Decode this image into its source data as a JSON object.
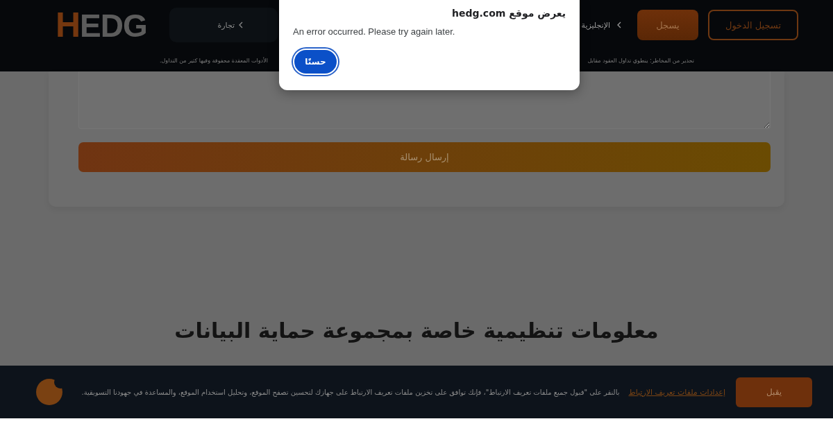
{
  "header": {
    "logo": {
      "accent": "H",
      "rest": "EDG"
    },
    "login_button": "تسجيل الدخول",
    "register_button": "يسجل",
    "language_menu": {
      "label": "الإنجليزية"
    },
    "trade_menu": {
      "label": "تجارة"
    },
    "risk_warning": [
      "تحذير من المخاطر: ينطوي تداول العقود مقابل",
      "الأدوات المعقدة محفوفة وفيها كثير من التداول."
    ]
  },
  "contact_form": {
    "send_button": "إرسال رسالة"
  },
  "section_heading": "معلومات تنظيمية خاصة بمجموعة حماية البيانات",
  "cookie_banner": {
    "accept_button": "يقبل",
    "settings_link": "إعدادات ملفات تعريف الارتباط",
    "text": "بالنقر على \"قبول جميع ملفات تعريف الارتباط\"، فإنك توافق على تخزين ملفات تعريف الارتباط على جهازك لتحسين تصفح الموقع، وتحليل استخدام الموقع، والمساعدة في جهودنا التسويقية."
  },
  "alert_dialog": {
    "title": "يعرض موقع hedg.com",
    "message": "An error occurred. Please try again later.",
    "ok_button": "حسنًا"
  }
}
